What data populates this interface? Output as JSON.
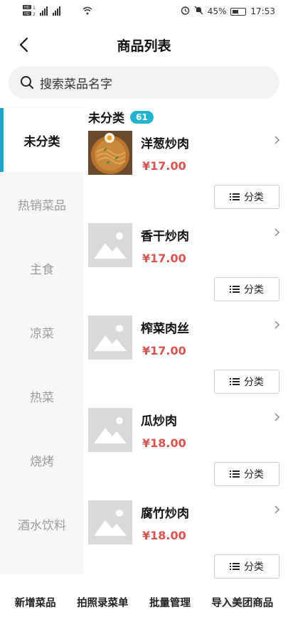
{
  "status_bar": {
    "signal_left": "HD 1 HD 2 4G 4G",
    "battery": "45%",
    "time": "17:53",
    "icons": [
      "sim-signal-icon",
      "wifi-icon",
      "alarm-icon",
      "mute-icon",
      "battery-icon"
    ]
  },
  "nav": {
    "title": "商品列表",
    "back_icon": "chevron-left-icon"
  },
  "search": {
    "placeholder": "搜索菜品名字",
    "icon": "search-icon"
  },
  "sidebar": {
    "items": [
      {
        "label": "未分类",
        "active": true
      },
      {
        "label": "热销菜品",
        "active": false
      },
      {
        "label": "主食",
        "active": false
      },
      {
        "label": "凉菜",
        "active": false
      },
      {
        "label": "热菜",
        "active": false
      },
      {
        "label": "烧烤",
        "active": false
      },
      {
        "label": "酒水饮料",
        "active": false
      }
    ],
    "accent_color": "#1aa7c9"
  },
  "section": {
    "title": "未分类",
    "count": "61"
  },
  "products": [
    {
      "name": "洋葱炒肉",
      "price": "¥17.00",
      "image": "photo",
      "category_button": "分类"
    },
    {
      "name": "香干炒肉",
      "price": "¥17.00",
      "image": "placeholder",
      "category_button": "分类"
    },
    {
      "name": "榨菜肉丝",
      "price": "¥17.00",
      "image": "placeholder",
      "category_button": "分类"
    },
    {
      "name": "瓜炒肉",
      "price": "¥18.00",
      "image": "placeholder",
      "category_button": "分类"
    },
    {
      "name": "腐竹炒肉",
      "price": "¥18.00",
      "image": "placeholder",
      "category_button": "分类"
    }
  ],
  "price_color": "#d9534f",
  "bottom_bar": {
    "items": [
      "新增菜品",
      "拍照录菜单",
      "批量管理",
      "导入美团商品"
    ]
  }
}
